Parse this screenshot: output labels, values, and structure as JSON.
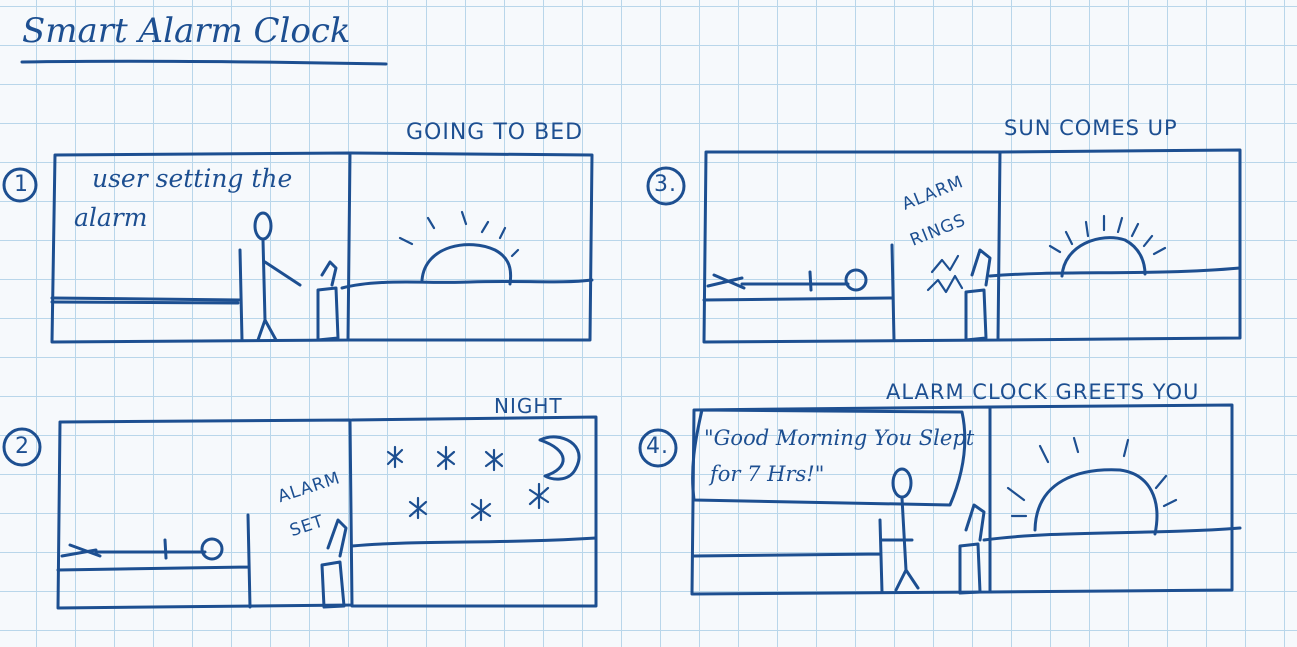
{
  "title": "Smart Alarm Clock",
  "panels": [
    {
      "number": "1",
      "caption": "GOING TO BED",
      "left_text_line1": "user setting the",
      "left_text_line2": "alarm"
    },
    {
      "number": "2",
      "caption": "NIGHT",
      "left_text_line1": "ALARM",
      "left_text_line2": "SET"
    },
    {
      "number": "3.",
      "caption": "SUN COMES UP",
      "left_text_line1": "ALARM",
      "left_text_line2": "RINGS"
    },
    {
      "number": "4.",
      "caption": "ALARM CLOCK GREETS YOU",
      "left_text_line1": "\"Good Morning You Slept",
      "left_text_line2": "for 7 Hrs!\""
    }
  ],
  "colors": {
    "ink": "#1d4f91",
    "grid": "#b9d6ea",
    "paper": "#f6f9fc"
  }
}
